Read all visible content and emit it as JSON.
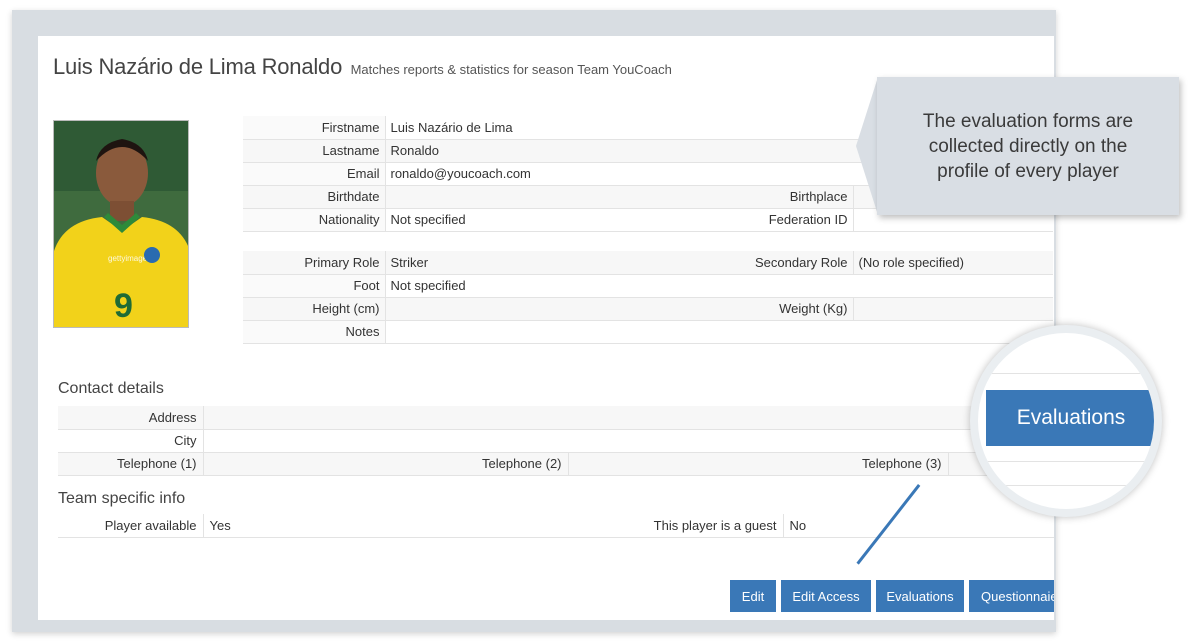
{
  "header": {
    "player_name": "Luis Nazário de Lima Ronaldo",
    "subtitle": "Matches reports & statistics for season Team YouCoach"
  },
  "profile": {
    "firstname_label": "Firstname",
    "firstname": "Luis Nazário de Lima",
    "lastname_label": "Lastname",
    "lastname": "Ronaldo",
    "email_label": "Email",
    "email": "ronaldo@youcoach.com",
    "birthdate_label": "Birthdate",
    "birthdate": "",
    "birthplace_label": "Birthplace",
    "birthplace": "",
    "nationality_label": "Nationality",
    "nationality": "Not specified",
    "federation_label": "Federation ID",
    "federation": ""
  },
  "role": {
    "primary_label": "Primary Role",
    "primary": "Striker",
    "secondary_label": "Secondary Role",
    "secondary": "(No role specified)",
    "foot_label": "Foot",
    "foot": "Not specified",
    "height_label": "Height (cm)",
    "height": "",
    "weight_label": "Weight (Kg)",
    "weight": "",
    "notes_label": "Notes",
    "notes": ""
  },
  "contact": {
    "title": "Contact details",
    "address_label": "Address",
    "city_label": "City",
    "tel1_label": "Telephone (1)",
    "tel2_label": "Telephone (2)",
    "tel3_label": "Telephone (3)"
  },
  "team_info": {
    "title": "Team specific info",
    "available_label": "Player available",
    "available": "Yes",
    "guest_label": "This player is a guest",
    "guest": "No"
  },
  "buttons": {
    "edit": "Edit",
    "edit_access": "Edit Access",
    "evaluations": "Evaluations",
    "questionnaire": "Questionnaie"
  },
  "callout": {
    "text": "The evaluation forms are collected directly on the profile of every player"
  },
  "magnifier": {
    "label": "Evaluations"
  },
  "colors": {
    "accent": "#3a78b7",
    "callout_bg": "#d9dee4"
  },
  "photo": {
    "watermark": "gettyimages",
    "shirt_number": "9"
  }
}
